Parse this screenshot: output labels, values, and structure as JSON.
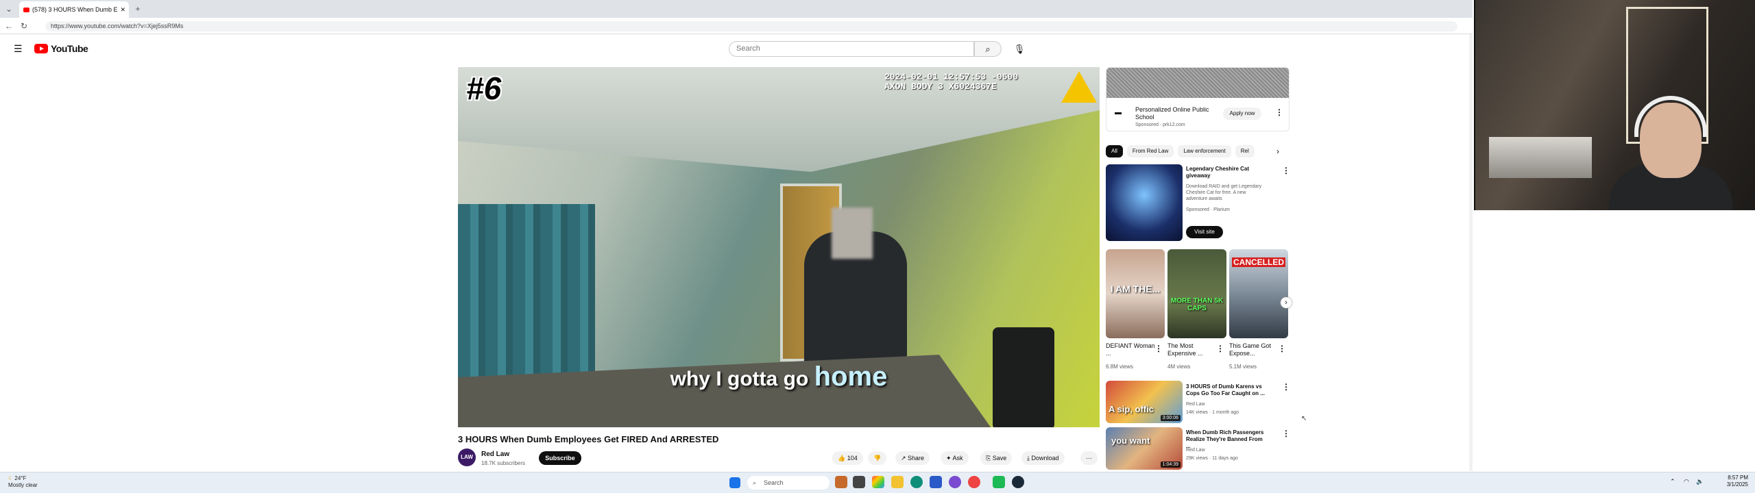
{
  "browser": {
    "tab_title": "(578) 3 HOURS When Dumb E",
    "url": "https://www.youtube.com/watch?v=Xjej5ssR9Ms"
  },
  "header": {
    "logo": "YouTube",
    "search_placeholder": "Search"
  },
  "video": {
    "overlay_episode": "#6",
    "overlay_timestamp": "2024-02-01 12:57:53 -0600",
    "overlay_device": "AXON BODY 3 X6024367E",
    "caption_pre": "why I gotta go",
    "caption_highlight": "home",
    "title": "3 HOURS When Dumb Employees Get FIRED And ARRESTED",
    "channel": "Red Law",
    "channel_avatar": "LAW",
    "subscribers": "18.7K subscribers",
    "subscribe_label": "Subscribe",
    "likes": "104",
    "share": "Share",
    "ask": "Ask",
    "save": "Save",
    "download": "Download"
  },
  "ad": {
    "title": "Personalized Online Public School",
    "sponsor": "Sponsored · prk12.com",
    "cta": "Apply now"
  },
  "chips": [
    "All",
    "From Red Law",
    "Law enforcement",
    "Rel"
  ],
  "promo": {
    "title": "Legendary Cheshire Cat giveaway",
    "desc": "Download RAID and get Legendary Cheshire Cat for free. A new adventure awaits",
    "sponsor": "Sponsored · Plarium",
    "cta": "Visit site"
  },
  "shorts": [
    {
      "title": "DEFIANT Woman ...",
      "views": "6.8M views",
      "overlay": "I AM THE..."
    },
    {
      "title": "The Most Expensive ...",
      "views": "4M views",
      "overlay": "MORE THAN 5K CAPS"
    },
    {
      "title": "This Game Got Expose...",
      "views": "5.1M views",
      "overlay": "CANCELLED"
    }
  ],
  "related": [
    {
      "title": "3 HOURS of Dumb Karens vs Cops Go Too Far Caught on ...",
      "channel": "Red Law",
      "meta": "14K views · 1 month ago",
      "duration": "3:00:06",
      "overlay": "A sip, offic"
    },
    {
      "title": "When Dumb Rich Passengers Realize They're Banned From ...",
      "channel": "Red Law",
      "meta": "29K views · 11 days ago",
      "duration": "1:04:39",
      "overlay": "you want"
    }
  ],
  "taskbar": {
    "weather_temp": "24°F",
    "weather_desc": "Mostly clear",
    "search": "Search",
    "time": "8:57 PM",
    "date": "3/1/2025"
  }
}
